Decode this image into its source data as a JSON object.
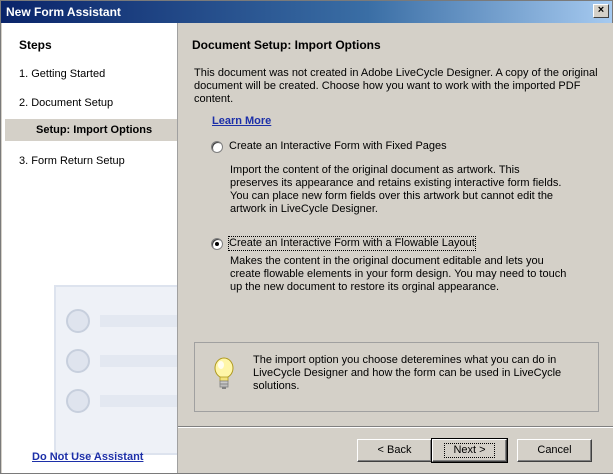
{
  "window": {
    "title": "New Form Assistant",
    "close_glyph": "×"
  },
  "sidebar": {
    "title": "Steps",
    "steps": [
      {
        "label": "1. Getting Started"
      },
      {
        "label": "2. Document Setup"
      },
      {
        "label": "Setup: Import Options",
        "active": true
      },
      {
        "label": "3. Form Return Setup"
      }
    ],
    "do_not_use_label": "Do Not Use Assistant"
  },
  "main": {
    "title": "Document Setup: Import Options",
    "intro": "This document was not created in Adobe LiveCycle Designer. A copy of the original document will be created. Choose how you want to work with the imported PDF content.",
    "learn_more": "Learn More",
    "options": [
      {
        "label": "Create an Interactive Form with Fixed Pages",
        "description": "Import the content of the original document as artwork. This preserves its appearance and retains existing interactive form fields. You can place new form fields over this artwork but cannot edit the artwork in LiveCycle Designer.",
        "selected": false
      },
      {
        "label": "Create an Interactive Form with a Flowable Layout",
        "description": "Makes the content in the original document editable and lets you create flowable elements in your form design. You may need to touch up the new document to restore its orginal appearance.",
        "selected": true
      }
    ],
    "info": {
      "icon": "lightbulb-icon",
      "text": "The import option you choose deteremines what you can do in LiveCycle Designer and how the form can be used in LiveCycle solutions."
    }
  },
  "buttons": {
    "back": "< Back",
    "next": "Next >",
    "cancel": "Cancel"
  }
}
